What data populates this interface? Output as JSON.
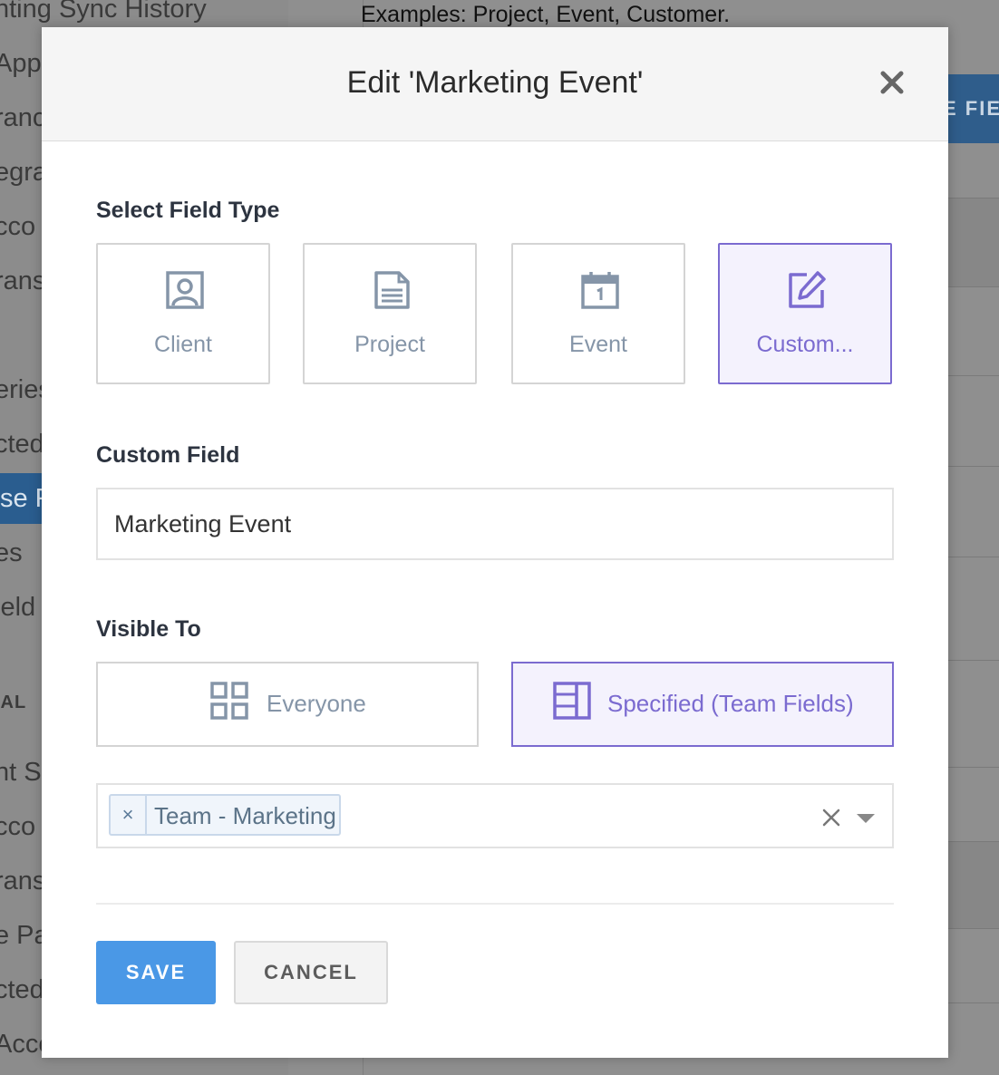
{
  "background": {
    "sidebar_items": [
      "nting Sync History",
      "App",
      "ranc",
      "egra",
      "cco",
      "rans",
      "eries",
      "cted",
      "se Fi",
      "es",
      "ield",
      "IAL",
      "nt Se",
      "cco",
      "rans",
      "e Pa",
      "cted",
      "Acco"
    ],
    "examples_text": "Examples: Project, Event, Customer.",
    "right_button_label": "E FIE"
  },
  "modal": {
    "title": "Edit 'Marketing Event'",
    "close_icon": "close-icon",
    "field_type_label": "Select Field Type",
    "field_types": [
      {
        "label": "Client",
        "icon": "client-icon",
        "selected": false
      },
      {
        "label": "Project",
        "icon": "project-icon",
        "selected": false
      },
      {
        "label": "Event",
        "icon": "calendar-icon",
        "selected": false
      },
      {
        "label": "Custom...",
        "icon": "edit-icon",
        "selected": true
      }
    ],
    "custom_field_label": "Custom Field",
    "custom_field_value": "Marketing Event",
    "visible_to_label": "Visible To",
    "visibility_options": [
      {
        "label": "Everyone",
        "icon": "grid-icon",
        "selected": false
      },
      {
        "label": "Specified (Team Fields)",
        "icon": "columns-icon",
        "selected": true
      }
    ],
    "selected_teams": [
      {
        "label": "Team - Marketing",
        "remove_symbol": "×"
      }
    ],
    "save_label": "SAVE",
    "cancel_label": "CANCEL"
  },
  "colors": {
    "accent": "#7b6bd0",
    "primary_button": "#4a98e6",
    "icon_gray": "#8595a8"
  }
}
